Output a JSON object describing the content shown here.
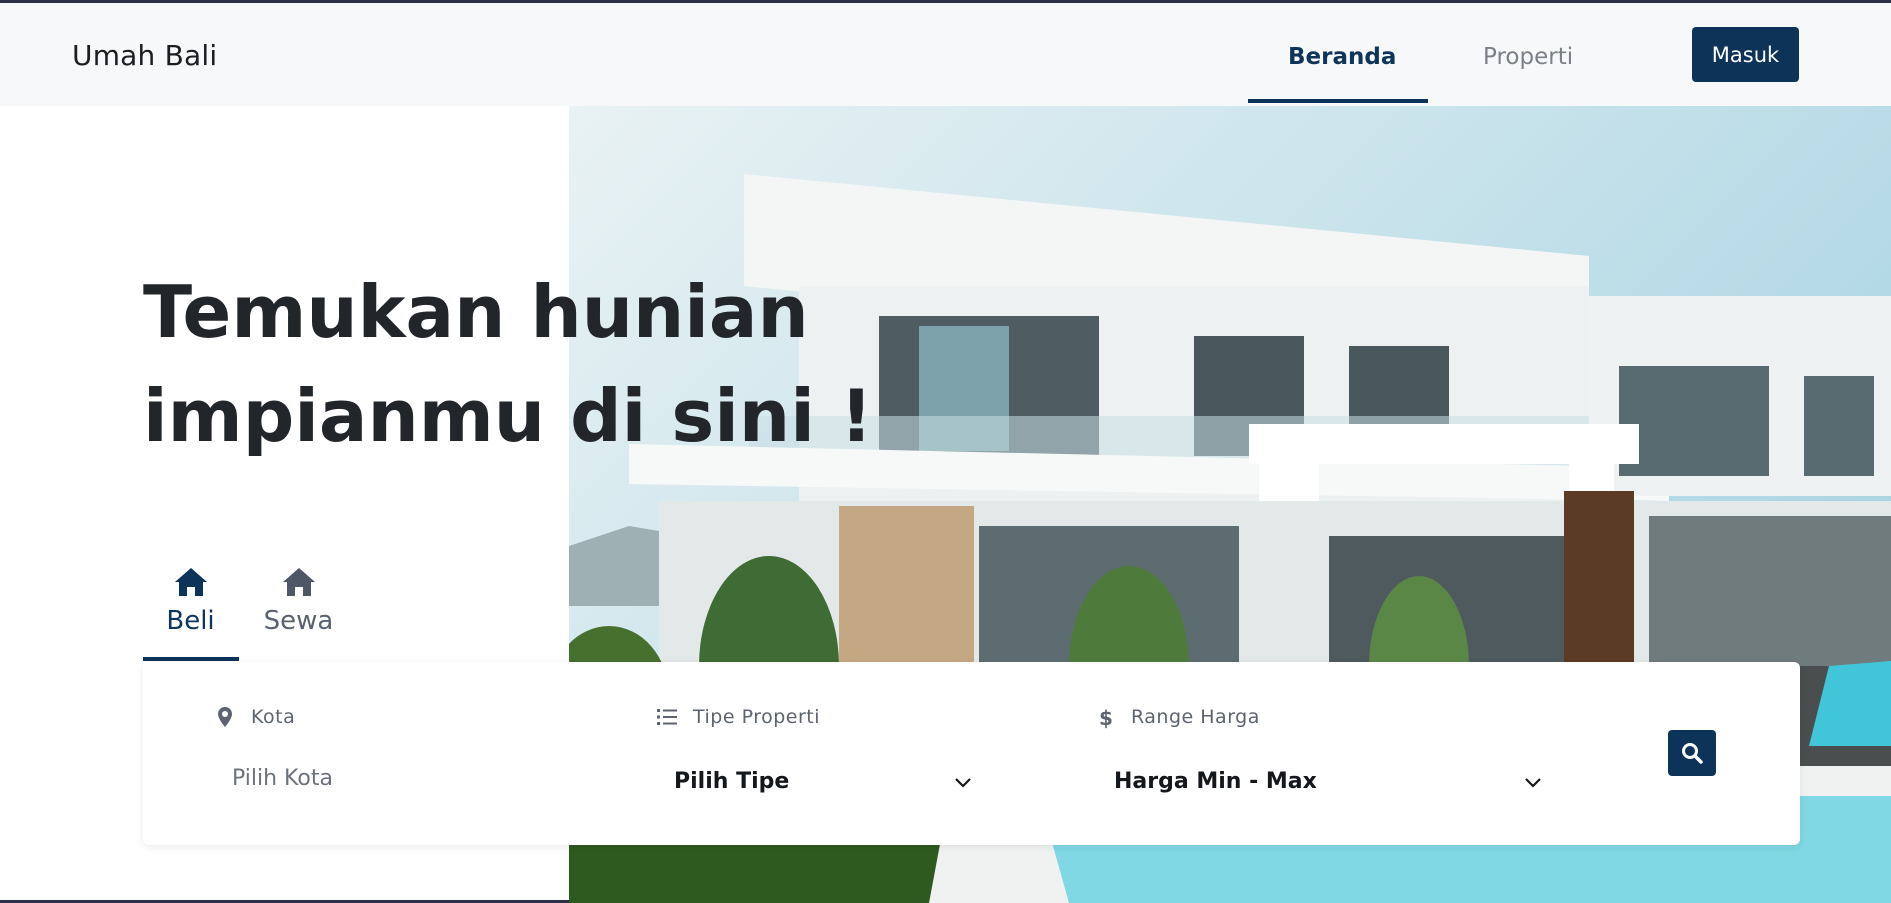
{
  "navbar": {
    "brand": "Umah Bali",
    "links": [
      {
        "label": "Beranda",
        "active": true
      },
      {
        "label": "Properti",
        "active": false
      }
    ],
    "login_label": "Masuk"
  },
  "hero": {
    "headline_line1": "Temukan hunian",
    "headline_line2": "impianmu di sini !"
  },
  "tabs": [
    {
      "label": "Beli",
      "icon": "home-icon",
      "active": true
    },
    {
      "label": "Sewa",
      "icon": "home-icon",
      "active": false
    }
  ],
  "search": {
    "city": {
      "label": "Kota",
      "icon": "map-pin-icon",
      "placeholder": "Pilih Kota"
    },
    "type": {
      "label": "Tipe Properti",
      "icon": "list-icon",
      "value": "Pilih Tipe"
    },
    "price": {
      "label": "Range Harga",
      "icon": "dollar-icon",
      "value": "Harga Min - Max"
    },
    "button_icon": "search-icon"
  },
  "colors": {
    "primary": "#0d3359",
    "navbar_bg": "#f7f8f9",
    "muted_text": "#7b8089"
  }
}
